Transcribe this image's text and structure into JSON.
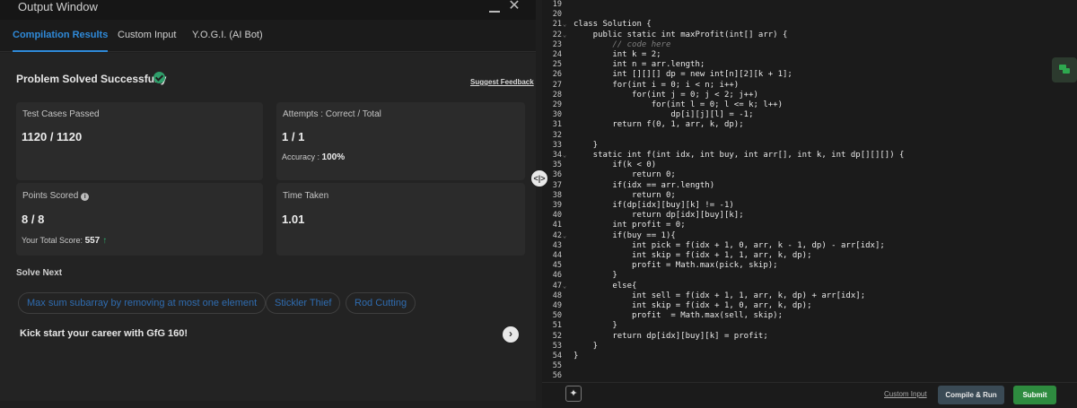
{
  "window": {
    "title": "Output Window",
    "minimize_icon": "minimize-icon",
    "close_icon": "close-icon"
  },
  "tabs": [
    {
      "label": "Compilation Results",
      "active": true
    },
    {
      "label": "Custom Input",
      "active": false
    },
    {
      "label": "Y.O.G.I. (AI Bot)",
      "active": false
    }
  ],
  "result": {
    "status": "Problem Solved Successfully",
    "status_icon": "check-circle-icon",
    "feedback_link": "Suggest Feedback",
    "success_color": "#2f9e6a"
  },
  "cards": {
    "test_cases": {
      "label": "Test Cases Passed",
      "value": "1120 / 1120"
    },
    "attempts": {
      "label": "Attempts : Correct / Total",
      "value": "1 / 1",
      "accuracy_label": "Accuracy :",
      "accuracy_value": "100%"
    },
    "points": {
      "label": "Points Scored",
      "value": "8 / 8",
      "total_label": "Your Total Score:",
      "total_value": "557"
    },
    "time": {
      "label": "Time Taken",
      "value": "1.01"
    }
  },
  "solve_next": {
    "heading": "Solve Next",
    "items": [
      "Max sum subarray by removing at most one element",
      "Stickler Thief",
      "Rod Cutting"
    ]
  },
  "promo": {
    "text": "Kick start your career with GfG 160!",
    "arrow_icon": "chevron-right-icon"
  },
  "editor": {
    "lines": [
      {
        "no": "19",
        "fold": false,
        "text": ""
      },
      {
        "no": "20",
        "fold": false,
        "text": ""
      },
      {
        "no": "21",
        "fold": true,
        "text": "class Solution {"
      },
      {
        "no": "22",
        "fold": true,
        "text": "    public static int maxProfit(int[] arr) {"
      },
      {
        "no": "23",
        "fold": false,
        "text": "        // code here"
      },
      {
        "no": "24",
        "fold": false,
        "text": "        int k = 2;"
      },
      {
        "no": "25",
        "fold": false,
        "text": "        int n = arr.length;"
      },
      {
        "no": "26",
        "fold": false,
        "text": "        int [][][] dp = new int[n][2][k + 1];"
      },
      {
        "no": "27",
        "fold": false,
        "text": "        for(int i = 0; i < n; i++)"
      },
      {
        "no": "28",
        "fold": false,
        "text": "            for(int j = 0; j < 2; j++)"
      },
      {
        "no": "29",
        "fold": false,
        "text": "                for(int l = 0; l <= k; l++)"
      },
      {
        "no": "30",
        "fold": false,
        "text": "                    dp[i][j][l] = -1;"
      },
      {
        "no": "31",
        "fold": false,
        "text": "        return f(0, 1, arr, k, dp);"
      },
      {
        "no": "32",
        "fold": false,
        "text": ""
      },
      {
        "no": "33",
        "fold": false,
        "text": "    }"
      },
      {
        "no": "34",
        "fold": true,
        "text": "    static int f(int idx, int buy, int arr[], int k, int dp[][][]) {"
      },
      {
        "no": "35",
        "fold": false,
        "text": "        if(k < 0)"
      },
      {
        "no": "36",
        "fold": false,
        "text": "            return 0;"
      },
      {
        "no": "37",
        "fold": false,
        "text": "        if(idx == arr.length)"
      },
      {
        "no": "38",
        "fold": false,
        "text": "            return 0;"
      },
      {
        "no": "39",
        "fold": false,
        "text": "        if(dp[idx][buy][k] != -1)"
      },
      {
        "no": "40",
        "fold": false,
        "text": "            return dp[idx][buy][k];"
      },
      {
        "no": "41",
        "fold": false,
        "text": "        int profit = 0;"
      },
      {
        "no": "42",
        "fold": true,
        "text": "        if(buy == 1){"
      },
      {
        "no": "43",
        "fold": false,
        "text": "            int pick = f(idx + 1, 0, arr, k - 1, dp) - arr[idx];"
      },
      {
        "no": "44",
        "fold": false,
        "text": "            int skip = f(idx + 1, 1, arr, k, dp);"
      },
      {
        "no": "45",
        "fold": false,
        "text": "            profit = Math.max(pick, skip);"
      },
      {
        "no": "46",
        "fold": false,
        "text": "        }"
      },
      {
        "no": "47",
        "fold": true,
        "text": "        else{"
      },
      {
        "no": "48",
        "fold": false,
        "text": "            int sell = f(idx + 1, 1, arr, k, dp) + arr[idx];"
      },
      {
        "no": "49",
        "fold": false,
        "text": "            int skip = f(idx + 1, 0, arr, k, dp);"
      },
      {
        "no": "50",
        "fold": false,
        "text": "            profit  = Math.max(sell, skip);"
      },
      {
        "no": "51",
        "fold": false,
        "text": "        }"
      },
      {
        "no": "52",
        "fold": false,
        "text": "        return dp[idx][buy][k] = profit;"
      },
      {
        "no": "53",
        "fold": false,
        "text": "    }"
      },
      {
        "no": "54",
        "fold": false,
        "text": "}"
      },
      {
        "no": "55",
        "fold": false,
        "text": ""
      },
      {
        "no": "56",
        "fold": false,
        "text": ""
      }
    ]
  },
  "bottom": {
    "bulb_icon": "lightbulb-icon",
    "custom_input": "Custom Input",
    "compile_run": "Compile & Run",
    "submit": "Submit"
  },
  "side_icon": "chat-icon"
}
